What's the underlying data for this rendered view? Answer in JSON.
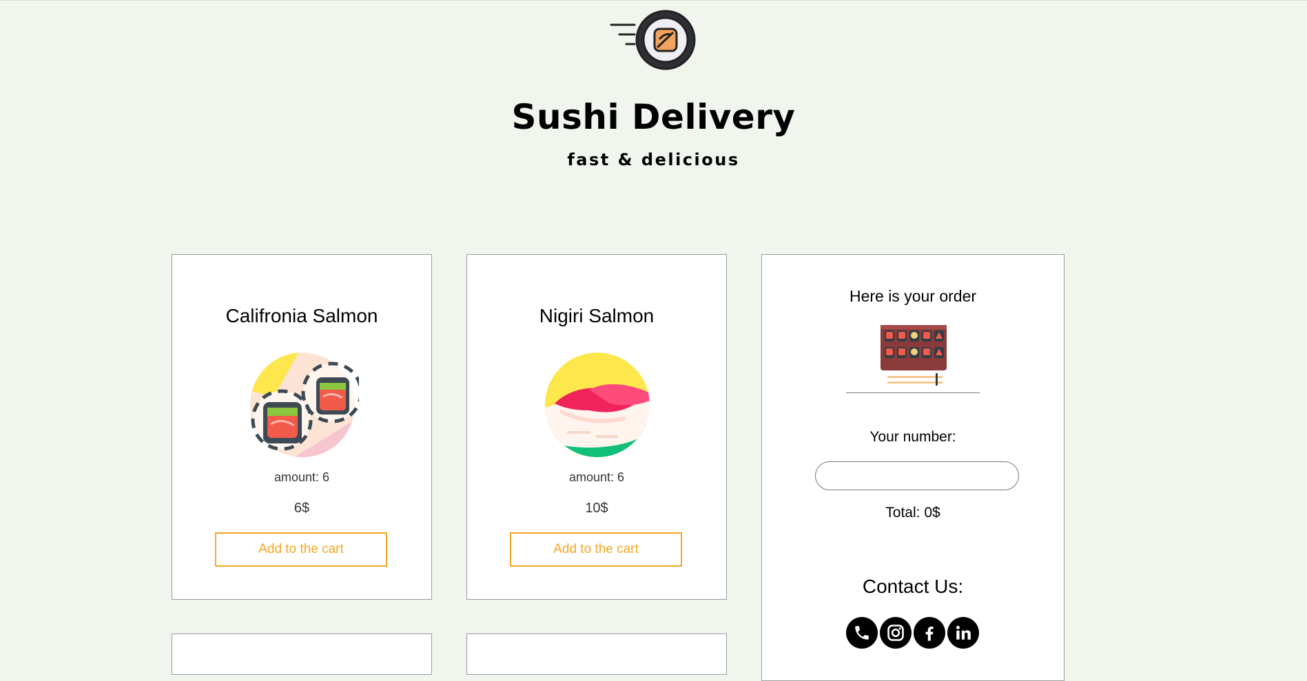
{
  "header": {
    "title": "Sushi Delivery",
    "subtitle": "fast & delicious",
    "logo_icon": "sushi-roll-logo-icon"
  },
  "products": [
    {
      "name": "Califronia Salmon",
      "amount": "amount: 6",
      "price": "6$",
      "button_label": "Add to the cart",
      "image_icon": "california-salmon-roll-icon"
    },
    {
      "name": "Nigiri Salmon",
      "amount": "amount: 6",
      "price": "10$",
      "button_label": "Add to the cart",
      "image_icon": "nigiri-salmon-icon"
    }
  ],
  "order": {
    "title": "Here is your order",
    "image_icon": "sushi-tray-icon",
    "number_label": "Your number:",
    "number_value": "",
    "total": "Total: 0$"
  },
  "contact": {
    "title": "Contact Us:",
    "icons": [
      "phone-icon",
      "instagram-icon",
      "facebook-icon",
      "linkedin-icon"
    ]
  },
  "colors": {
    "background": "#f0f6ee",
    "accent": "#f5a623",
    "card": "#ffffff"
  }
}
